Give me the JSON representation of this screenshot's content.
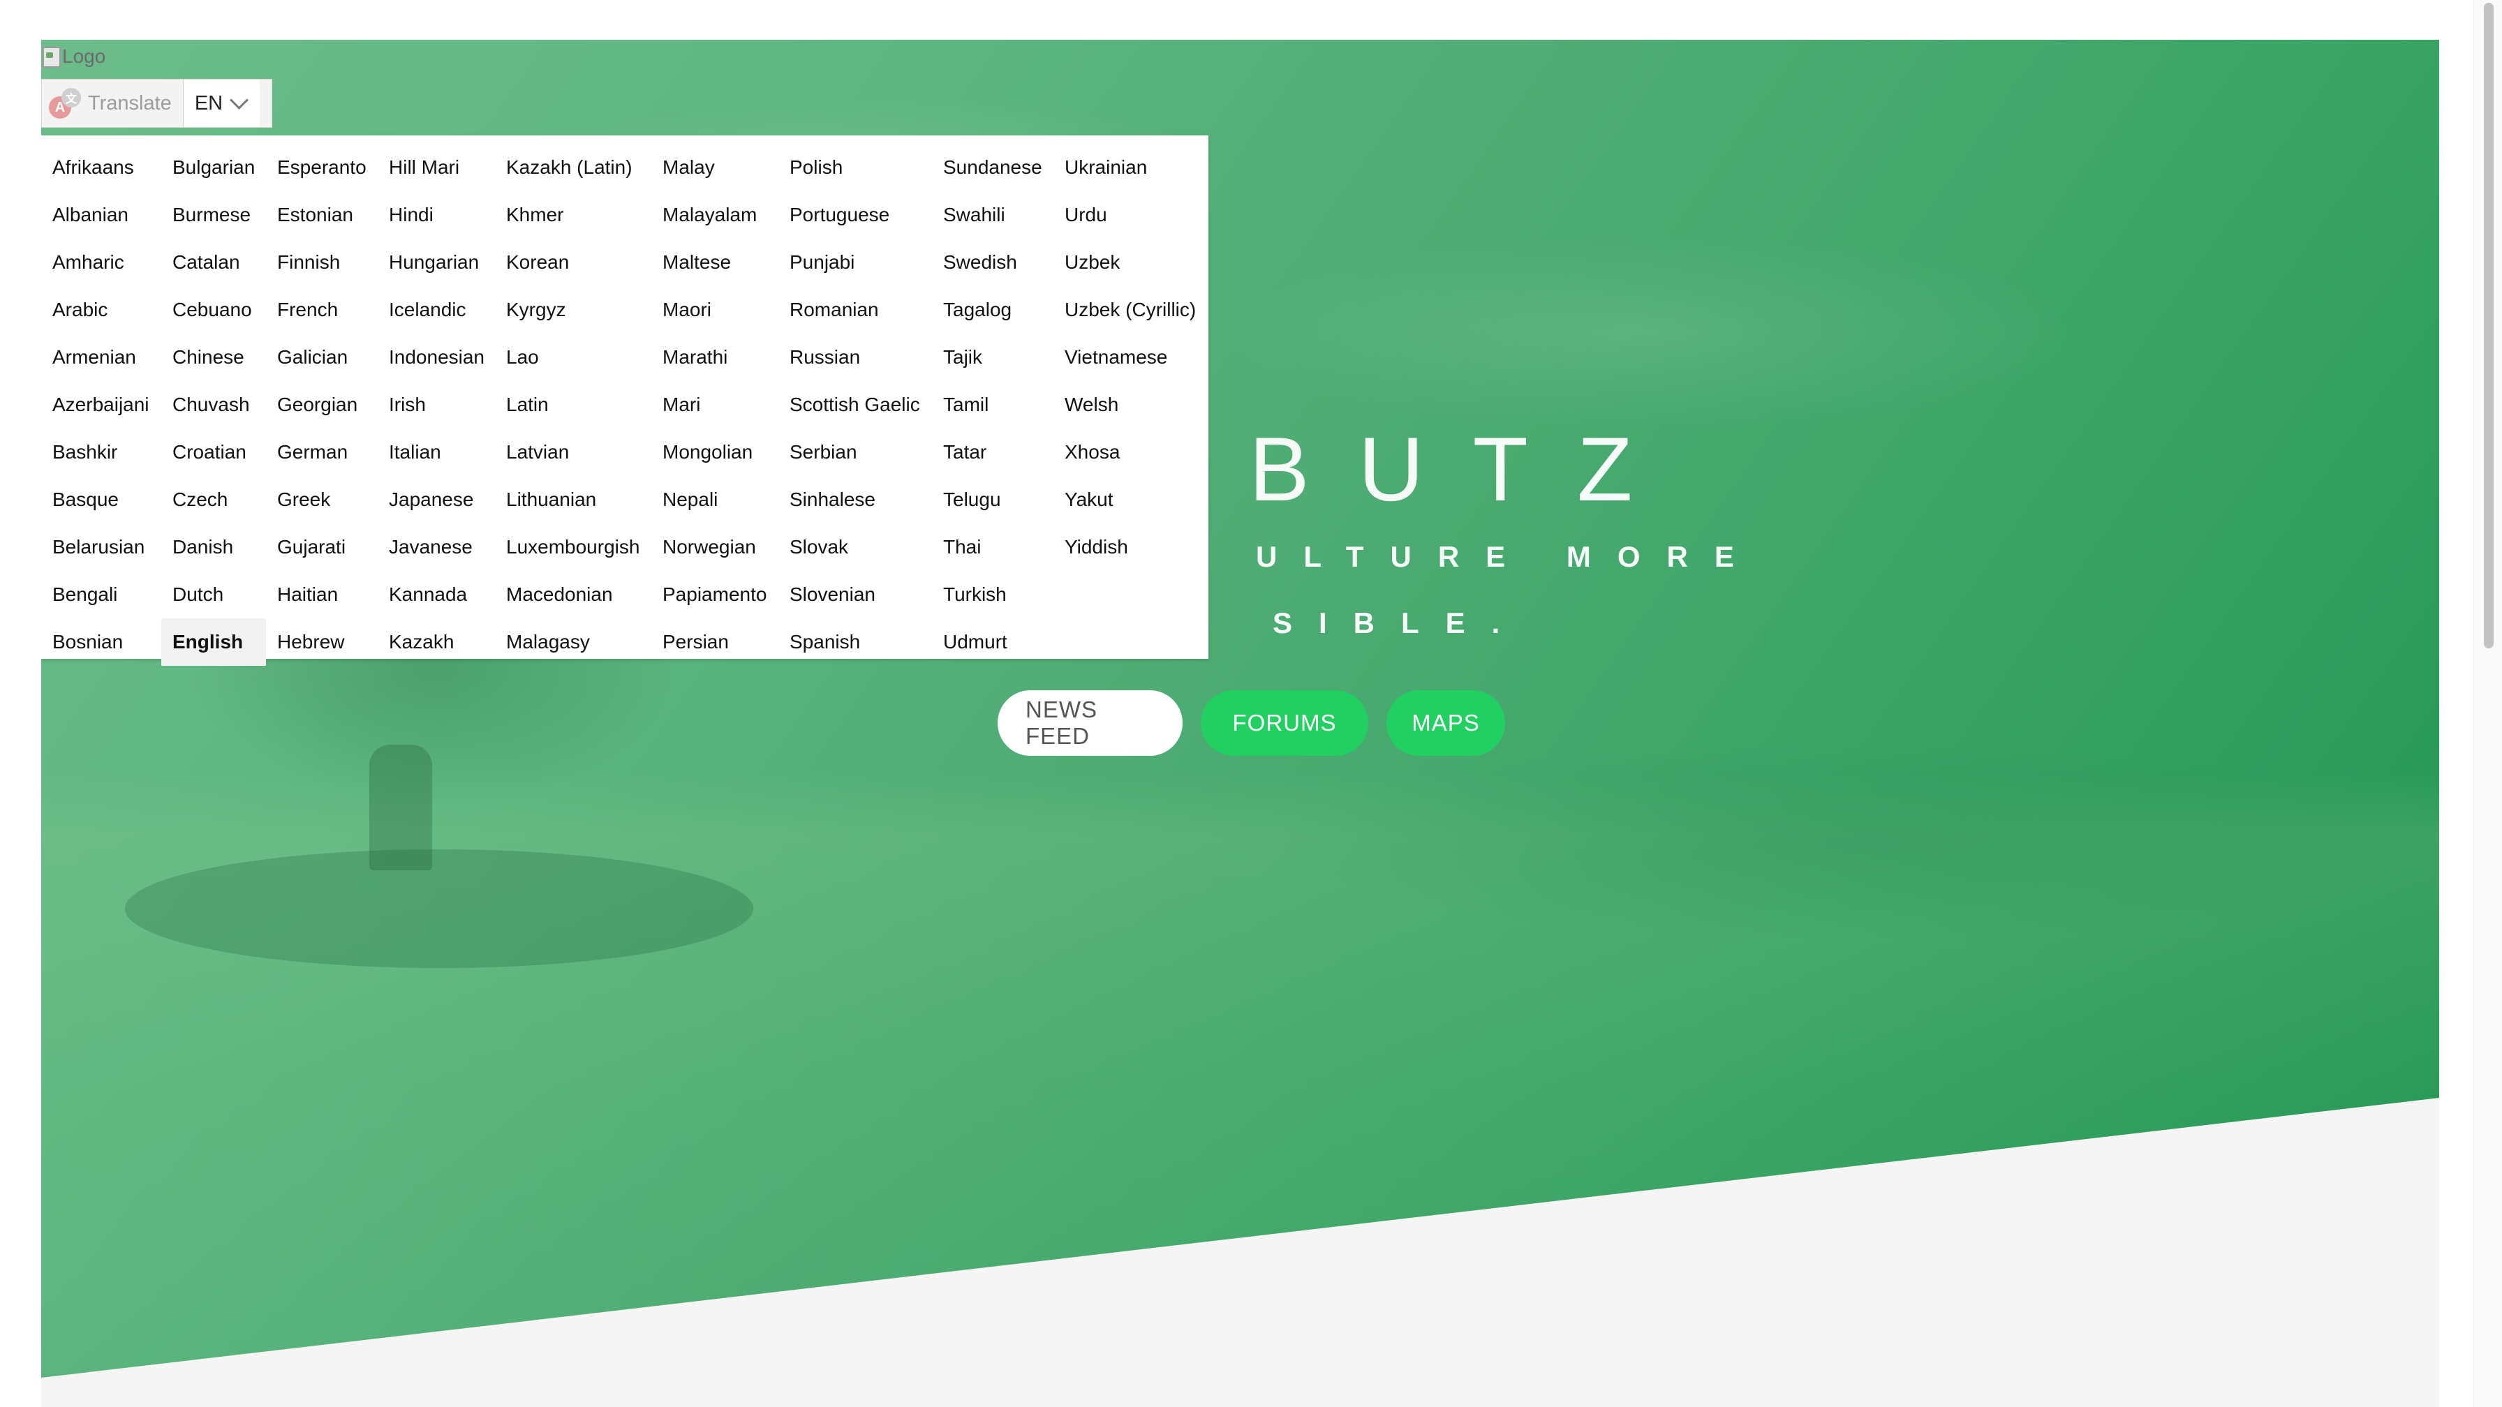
{
  "logo": {
    "alt_text": "Logo"
  },
  "translate": {
    "label": "Translate",
    "current_lang": "EN",
    "icon_letters": [
      "A",
      "文"
    ]
  },
  "languages": {
    "selected": "English",
    "columns": [
      [
        "Afrikaans",
        "Albanian",
        "Amharic",
        "Arabic",
        "Armenian",
        "Azerbaijani",
        "Bashkir",
        "Basque",
        "Belarusian",
        "Bengali",
        "Bosnian"
      ],
      [
        "Bulgarian",
        "Burmese",
        "Catalan",
        "Cebuano",
        "Chinese",
        "Chuvash",
        "Croatian",
        "Czech",
        "Danish",
        "Dutch",
        "English"
      ],
      [
        "Esperanto",
        "Estonian",
        "Finnish",
        "French",
        "Galician",
        "Georgian",
        "German",
        "Greek",
        "Gujarati",
        "Haitian",
        "Hebrew"
      ],
      [
        "Hill Mari",
        "Hindi",
        "Hungarian",
        "Icelandic",
        "Indonesian",
        "Irish",
        "Italian",
        "Japanese",
        "Javanese",
        "Kannada",
        "Kazakh"
      ],
      [
        "Kazakh (Latin)",
        "Khmer",
        "Korean",
        "Kyrgyz",
        "Lao",
        "Latin",
        "Latvian",
        "Lithuanian",
        "Luxembourgish",
        "Macedonian",
        "Malagasy"
      ],
      [
        "Malay",
        "Malayalam",
        "Maltese",
        "Maori",
        "Marathi",
        "Mari",
        "Mongolian",
        "Nepali",
        "Norwegian",
        "Papiamento",
        "Persian"
      ],
      [
        "Polish",
        "Portuguese",
        "Punjabi",
        "Romanian",
        "Russian",
        "Scottish Gaelic",
        "Serbian",
        "Sinhalese",
        "Slovak",
        "Slovenian",
        "Spanish"
      ],
      [
        "Sundanese",
        "Swahili",
        "Swedish",
        "Tagalog",
        "Tajik",
        "Tamil",
        "Tatar",
        "Telugu",
        "Thai",
        "Turkish",
        "Udmurt"
      ],
      [
        "Ukrainian",
        "Urdu",
        "Uzbek",
        "Uzbek (Cyrillic)",
        "Vietnamese",
        "Welsh",
        "Xhosa",
        "Yakut",
        "Yiddish"
      ]
    ]
  },
  "hero": {
    "title_visible": "BUTZ",
    "subtitle_line1_visible": "ULTURE MORE",
    "subtitle_line2_visible": "SIBLE."
  },
  "buttons": {
    "news_feed": "NEWS FEED",
    "forums": "FORUMS",
    "maps": "MAPS"
  },
  "colors": {
    "hero_green": "#3aa466",
    "button_green": "#22d062",
    "dropdown_bg": "#ffffff"
  }
}
